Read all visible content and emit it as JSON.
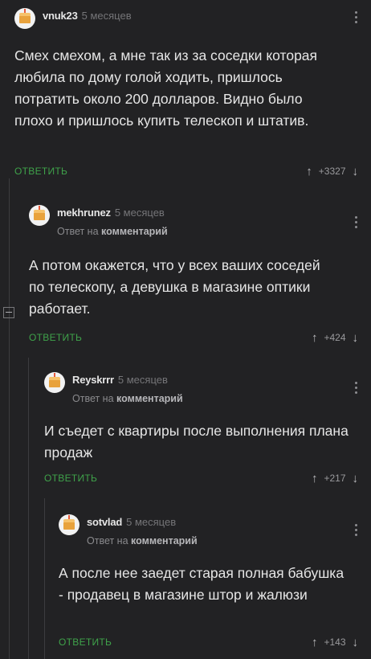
{
  "reply_label": "ОТВЕТИТЬ",
  "comments": [
    {
      "author": "vnuk23",
      "time": "5 месяцев",
      "text": "Смех смехом, а мне так из за соседки которая любила по дому голой ходить, пришлось потратить около 200 долларов. Видно было плохо и пришлось купить телескоп и штатив.",
      "rating": "+3327"
    },
    {
      "author": "mekhrunez",
      "time": "5 месяцев",
      "reply_prefix": "Ответ на",
      "reply_link": "комментарий",
      "text": "А потом окажется, что у всех ваших соседей по телескопу, а девушка в магазине оптики работает.",
      "rating": "+424"
    },
    {
      "author": "Reyskrrr",
      "time": "5 месяцев",
      "reply_prefix": "Ответ на",
      "reply_link": "комментарий",
      "text": "И съедет с квартиры после выполнения плана продаж",
      "rating": "+217"
    },
    {
      "author": "sotvlad",
      "time": "5 месяцев",
      "reply_prefix": "Ответ на",
      "reply_link": "комментарий",
      "text": "А после нее заедет старая полная бабушка - продавец в магазине штор и жалюзи",
      "rating": "+143"
    }
  ],
  "icons": {
    "avatar": "cake-icon",
    "menu": "more-vertical-icon",
    "upvote": "arrow-up-icon",
    "downvote": "arrow-down-icon",
    "collapse": "collapse-minus-icon"
  }
}
